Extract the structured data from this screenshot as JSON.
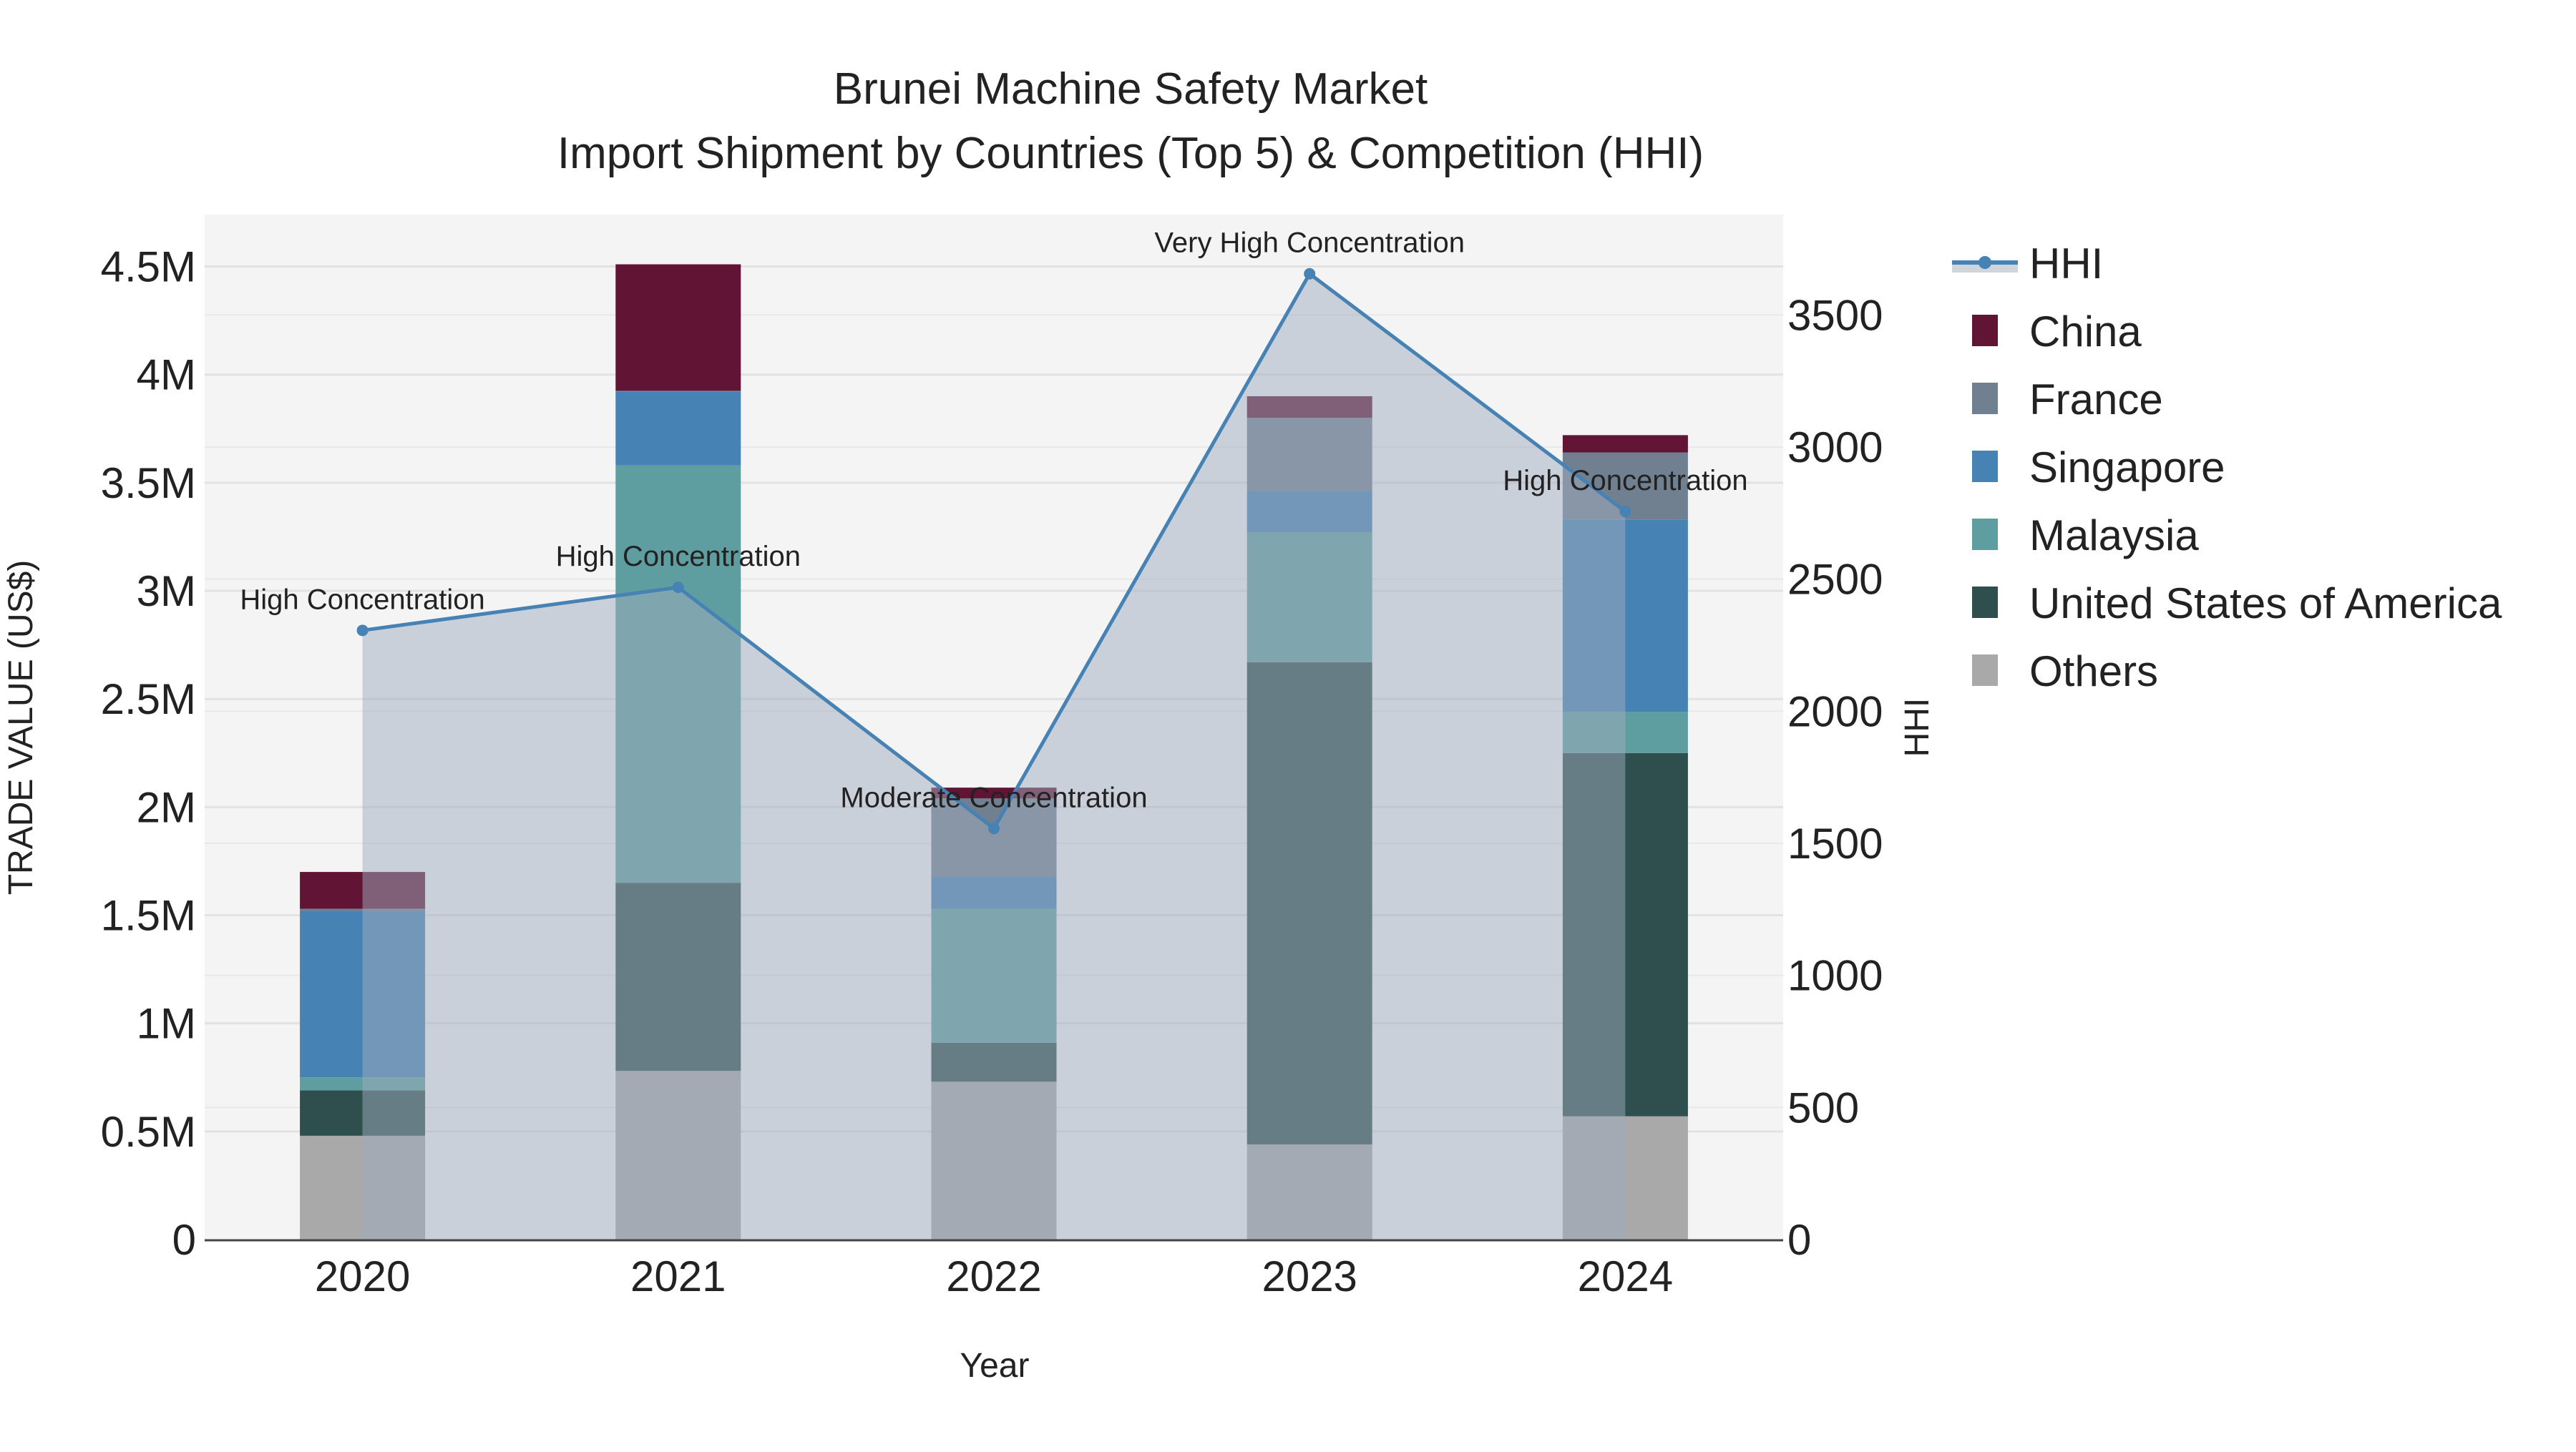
{
  "chart_data": {
    "type": "bar",
    "title": "Brunei Machine Safety Market",
    "subtitle": "Import Shipment by Countries (Top 5) & Competition (HHI)",
    "xlabel": "Year",
    "ylabel": "TRADE VALUE (US$)",
    "y2label": "HHI",
    "categories": [
      "2020",
      "2021",
      "2022",
      "2023",
      "2024"
    ],
    "ylim": [
      0,
      4740000
    ],
    "y2lim": [
      0,
      3880
    ],
    "yticks": [
      {
        "v": 0,
        "label": "0"
      },
      {
        "v": 500000,
        "label": "0.5M"
      },
      {
        "v": 1000000,
        "label": "1M"
      },
      {
        "v": 1500000,
        "label": "1.5M"
      },
      {
        "v": 2000000,
        "label": "2M"
      },
      {
        "v": 2500000,
        "label": "2.5M"
      },
      {
        "v": 3000000,
        "label": "3M"
      },
      {
        "v": 3500000,
        "label": "3.5M"
      },
      {
        "v": 4000000,
        "label": "4M"
      },
      {
        "v": 4500000,
        "label": "4.5M"
      }
    ],
    "y2ticks": [
      {
        "v": 0,
        "label": "0"
      },
      {
        "v": 500,
        "label": "500"
      },
      {
        "v": 1000,
        "label": "1000"
      },
      {
        "v": 1500,
        "label": "1500"
      },
      {
        "v": 2000,
        "label": "2000"
      },
      {
        "v": 2500,
        "label": "2500"
      },
      {
        "v": 3000,
        "label": "3000"
      },
      {
        "v": 3500,
        "label": "3500"
      }
    ],
    "stacked": true,
    "series": [
      {
        "name": "Others",
        "color": "#A9A9A9",
        "values": [
          480000,
          780000,
          730000,
          440000,
          570000
        ]
      },
      {
        "name": "United States of America",
        "color": "#2F4F4F",
        "values": [
          210000,
          870000,
          180000,
          2230000,
          1680000
        ]
      },
      {
        "name": "Malaysia",
        "color": "#5F9EA0",
        "values": [
          60000,
          1930000,
          620000,
          600000,
          190000
        ]
      },
      {
        "name": "Singapore",
        "color": "#4682B4",
        "values": [
          770000,
          340000,
          150000,
          190000,
          890000
        ]
      },
      {
        "name": "France",
        "color": "#708090",
        "values": [
          10000,
          5000,
          360000,
          340000,
          310000
        ]
      },
      {
        "name": "China",
        "color": "#611434",
        "values": [
          170000,
          585000,
          50000,
          100000,
          80000
        ]
      }
    ],
    "legend_order": [
      "China",
      "France",
      "Singapore",
      "Malaysia",
      "United States of America",
      "Others"
    ],
    "hhi": {
      "name": "HHI",
      "color": "#4682B4",
      "values": [
        2306,
        2469,
        1556,
        3656,
        2756
      ],
      "annotations": [
        "High Concentration",
        "High Concentration",
        "Moderate Concentration",
        "Very High Concentration",
        "High Concentration"
      ]
    },
    "legend_placement": "right",
    "grid": true
  }
}
